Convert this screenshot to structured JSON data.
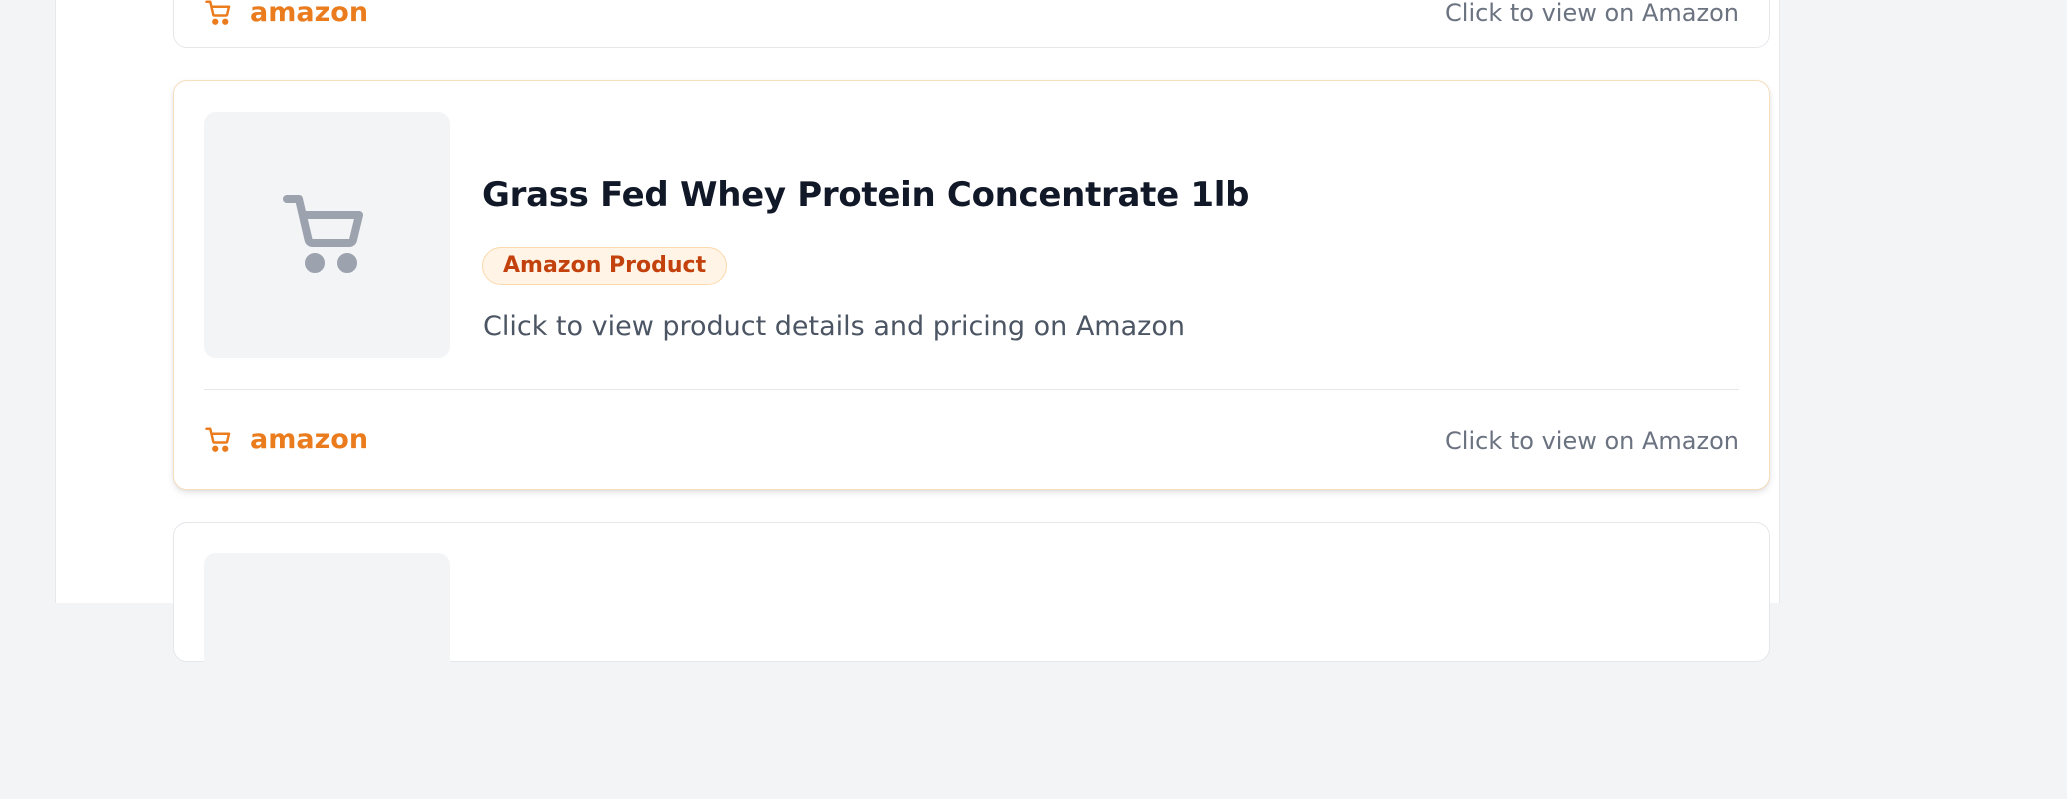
{
  "products": [
    {
      "footer": {
        "brand": "amazon",
        "cta": "Click to view on Amazon"
      }
    },
    {
      "title": "Grass Fed Whey Protein Concentrate 1lb",
      "badge": "Amazon Product",
      "description": "Click to view product details and pricing on Amazon",
      "thumbnail_icon": "shopping-cart-icon",
      "footer": {
        "brand": "amazon",
        "cta": "Click to view on Amazon"
      }
    },
    {
      "thumbnail_icon": "image-placeholder"
    }
  ],
  "colors": {
    "accent": "#ea7c1e",
    "badge_text": "#c2410c",
    "badge_bg": "#fff4e5",
    "title": "#111827",
    "muted": "#6b7280"
  }
}
